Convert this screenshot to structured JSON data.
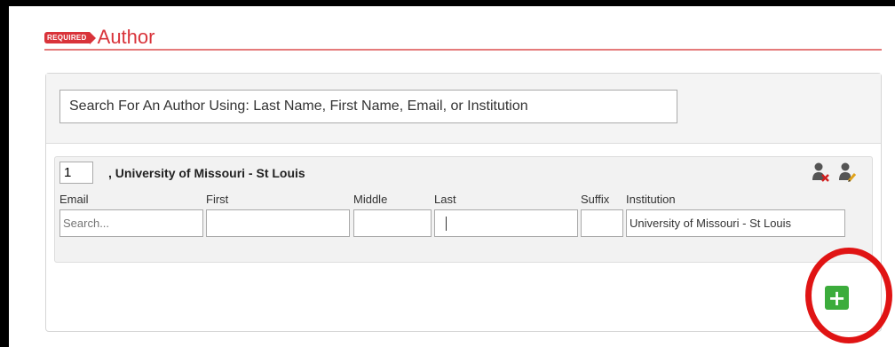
{
  "section": {
    "required_badge": "REQUIRED",
    "title": "Author"
  },
  "search": {
    "value": "Search For An Author Using: Last Name, First Name, Email, or Institution"
  },
  "author": {
    "order": "1",
    "heading": ", University of Missouri - St Louis",
    "labels": {
      "email": "Email",
      "first": "First",
      "middle": "Middle",
      "last": "Last",
      "suffix": "Suffix",
      "institution": "Institution"
    },
    "fields": {
      "email_placeholder": "Search...",
      "first": "",
      "middle": "",
      "last": "",
      "suffix": "",
      "institution": "University of Missouri - St Louis"
    },
    "icons": {
      "remove": "remove-author-icon",
      "edit": "edit-author-icon"
    }
  },
  "add_button": {
    "icon": "plus-icon",
    "glyph": "+"
  },
  "colors": {
    "accent_red": "#d9333a",
    "add_green": "#3cac3c",
    "highlight_red": "#e01414"
  }
}
